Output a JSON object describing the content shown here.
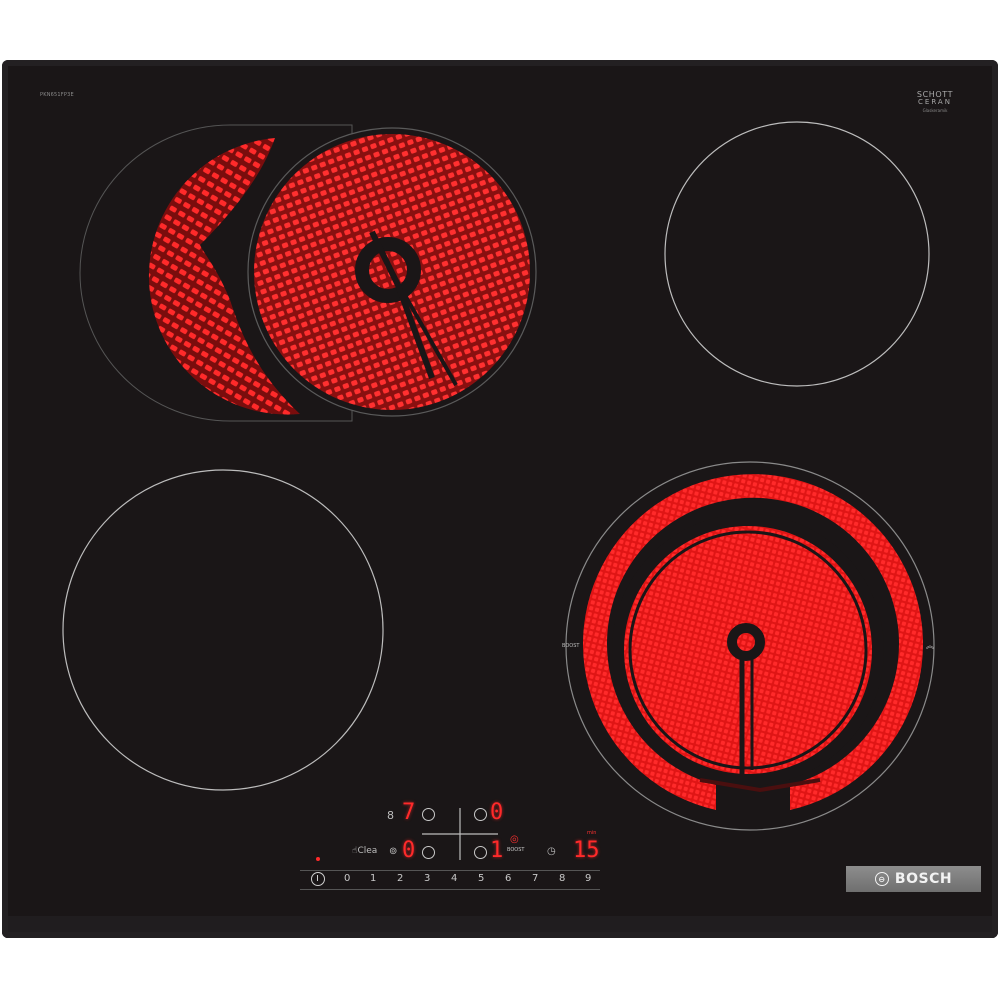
{
  "model_code": "PKN651FP3E",
  "glass_brand": {
    "line1": "SCHOTT",
    "line2": "CERAN",
    "line3": "Glaskeramik"
  },
  "brand": {
    "name": "BOSCH"
  },
  "colors": {
    "frame": "#1a1617",
    "glow": "#ff2020",
    "display": "#ff2a2a",
    "badge": "#7e7e7e"
  },
  "zones": [
    {
      "id": "front-left-extended",
      "state": "on"
    },
    {
      "id": "top-right",
      "state": "off"
    },
    {
      "id": "bottom-left",
      "state": "off"
    },
    {
      "id": "bottom-right-dual",
      "state": "on",
      "label": "BOOST"
    }
  ],
  "controls": {
    "zone_display_top_left": "7",
    "zone_display_top_right": "0",
    "zone_display_bottom_left": "0",
    "zone_display_bottom_right": "1",
    "wipe_protect_label": "Clea",
    "boost_label": "BOOST",
    "timer_display": "15",
    "timer_unit": "min",
    "slider_ticks": [
      "0",
      "1",
      "2",
      "3",
      "4",
      "5",
      "6",
      "7",
      "8",
      "9"
    ]
  }
}
